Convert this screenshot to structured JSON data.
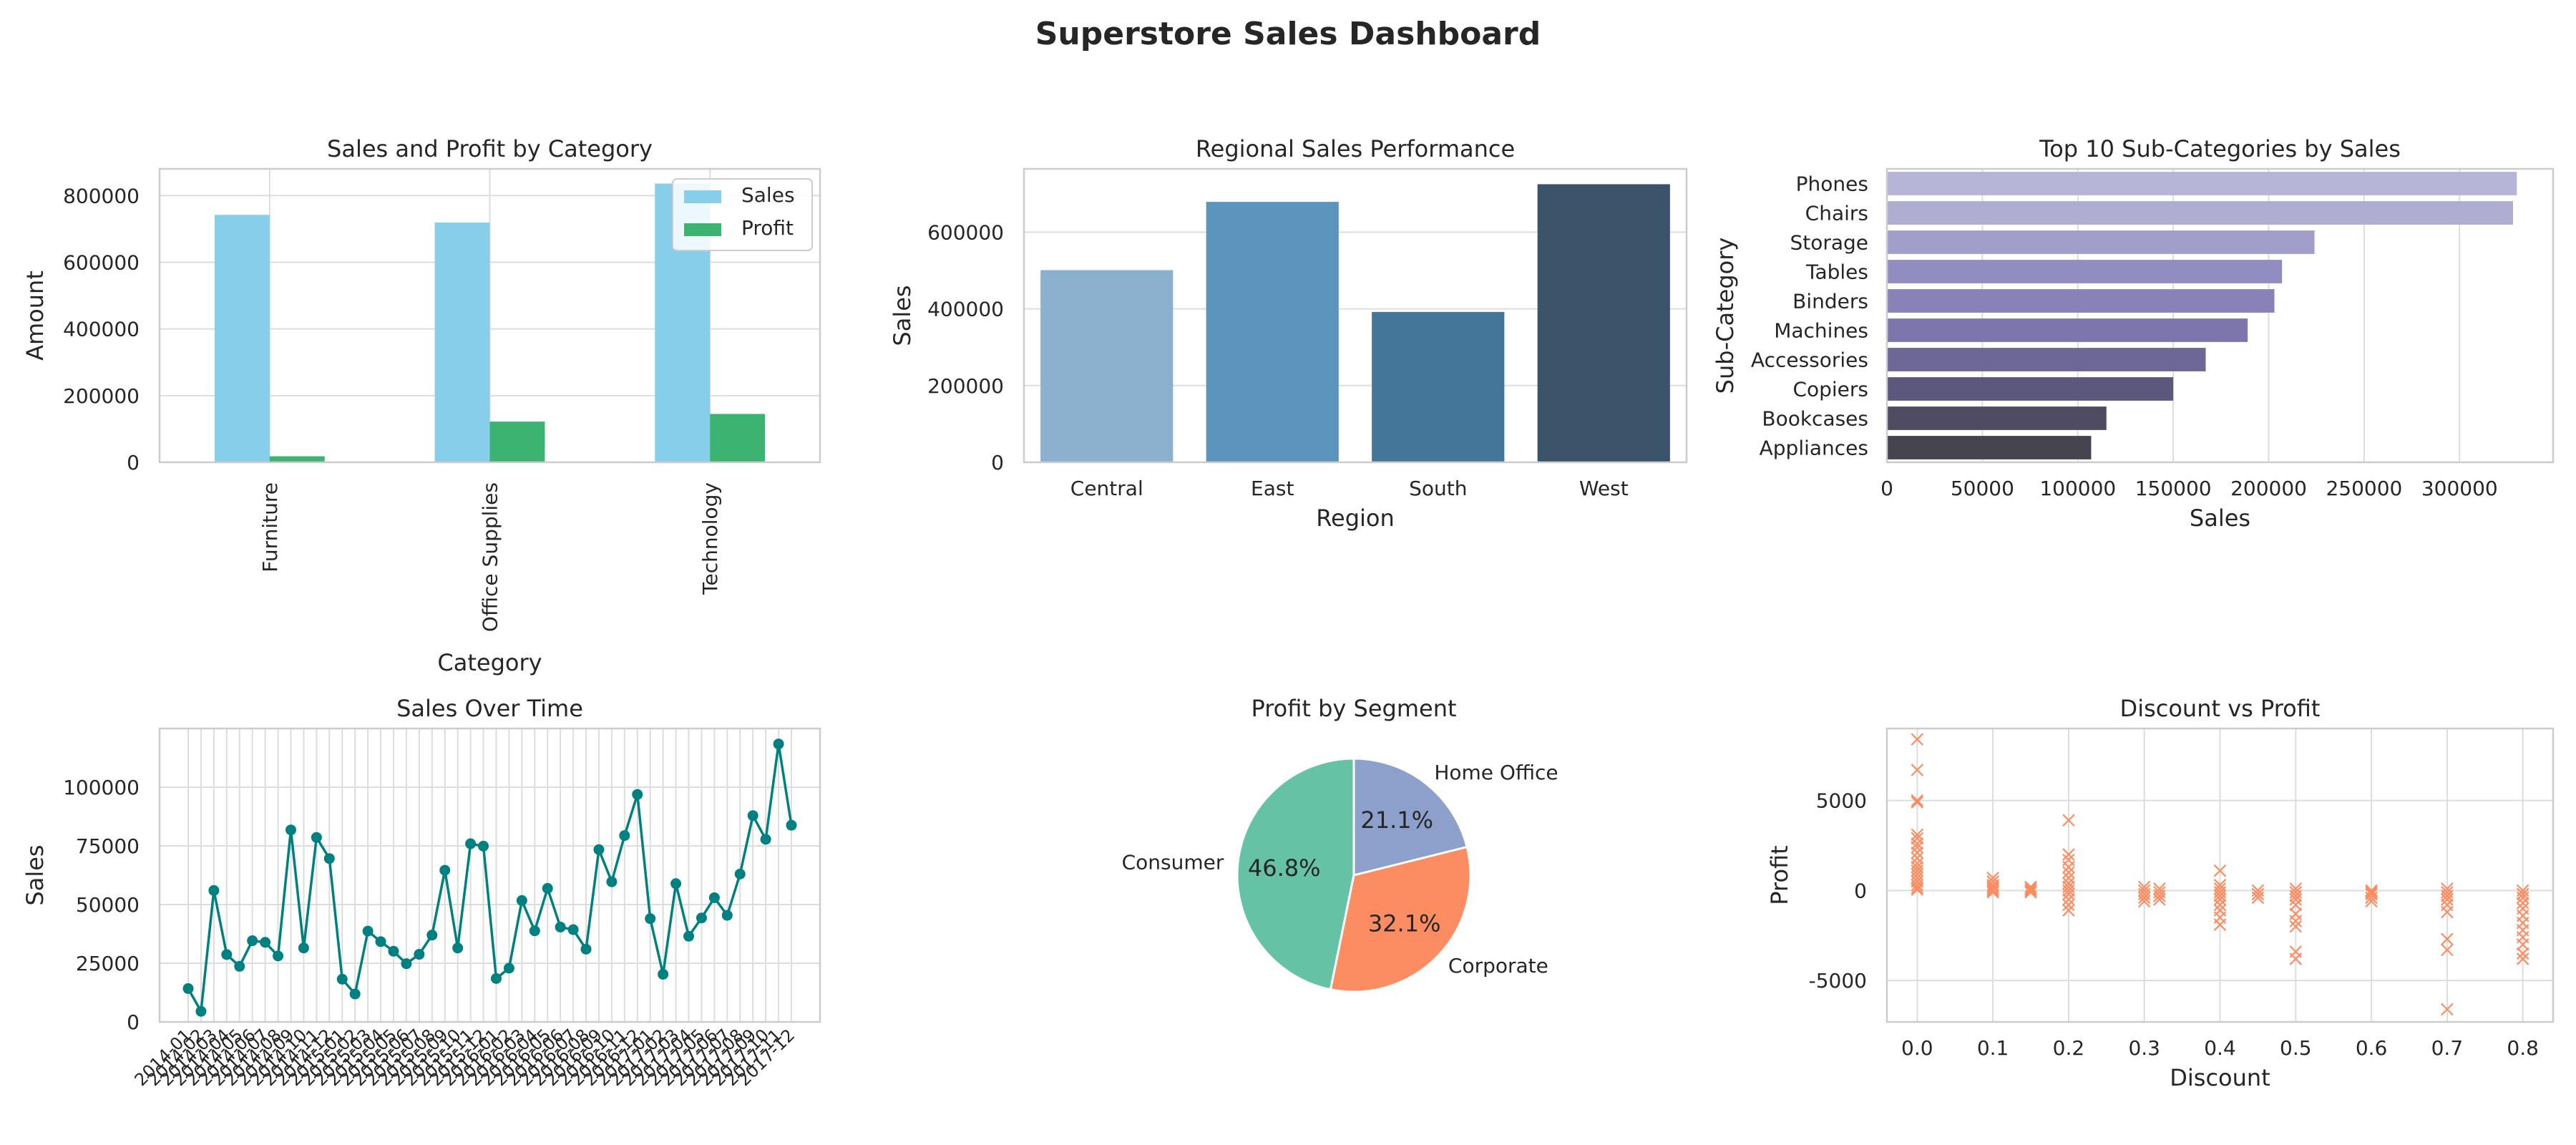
{
  "title": "Superstore Sales Dashboard",
  "colors": {
    "sales": "#87ceeb",
    "profit": "#3cb371",
    "region": [
      "#8ab0cd",
      "#5d94bd",
      "#447699",
      "#3b5369"
    ],
    "subcat": [
      "#b7b5d7",
      "#afacd2",
      "#a19ec9",
      "#928dc0",
      "#8882b8",
      "#7c76ad",
      "#6d6796",
      "#5c587d",
      "#4e4b63",
      "#45434d"
    ],
    "timeline": "#008080",
    "pie": [
      "#66c2a5",
      "#fc8d62",
      "#8da0cb"
    ],
    "scatter": "#fc8d62",
    "grid": "#dddddd",
    "spine": "#cccccc"
  },
  "chart_data": [
    {
      "type": "bar",
      "title": "Sales and Profit by Category",
      "xlabel": "Category",
      "ylabel": "Amount",
      "categories": [
        "Furniture",
        "Office Supplies",
        "Technology"
      ],
      "series": [
        {
          "name": "Sales",
          "values": [
            742000,
            719000,
            836000
          ]
        },
        {
          "name": "Profit",
          "values": [
            18000,
            122000,
            145000
          ]
        }
      ],
      "ylim": [
        0,
        880000
      ],
      "yticks": [
        0,
        200000,
        400000,
        600000,
        800000
      ],
      "legend": "top-right",
      "grid": true
    },
    {
      "type": "bar",
      "title": "Regional Sales Performance",
      "xlabel": "Region",
      "ylabel": "Sales",
      "categories": [
        "Central",
        "East",
        "South",
        "West"
      ],
      "values": [
        501000,
        679000,
        392000,
        725000
      ],
      "ylim": [
        0,
        765000
      ],
      "yticks": [
        0,
        200000,
        400000,
        600000
      ],
      "grid": true
    },
    {
      "type": "bar",
      "orientation": "horizontal",
      "title": "Top 10 Sub-Categories by Sales",
      "xlabel": "Sales",
      "ylabel": "Sub-Category",
      "categories": [
        "Phones",
        "Chairs",
        "Storage",
        "Tables",
        "Binders",
        "Machines",
        "Accessories",
        "Copiers",
        "Bookcases",
        "Appliances"
      ],
      "values": [
        330000,
        328000,
        224000,
        207000,
        203000,
        189000,
        167000,
        150000,
        115000,
        107000
      ],
      "xlim": [
        0,
        349000
      ],
      "xticks": [
        0,
        50000,
        100000,
        150000,
        200000,
        250000,
        300000
      ],
      "grid": true
    },
    {
      "type": "line",
      "title": "Sales Over Time",
      "xlabel": "",
      "ylabel": "Sales",
      "x": [
        "2014-01",
        "2014-02",
        "2014-03",
        "2014-04",
        "2014-05",
        "2014-06",
        "2014-07",
        "2014-08",
        "2014-09",
        "2014-10",
        "2014-11",
        "2014-12",
        "2015-01",
        "2015-02",
        "2015-03",
        "2015-04",
        "2015-05",
        "2015-06",
        "2015-07",
        "2015-08",
        "2015-09",
        "2015-10",
        "2015-11",
        "2015-12",
        "2016-01",
        "2016-02",
        "2016-03",
        "2016-04",
        "2016-05",
        "2016-06",
        "2016-07",
        "2016-08",
        "2016-09",
        "2016-10",
        "2016-11",
        "2016-12",
        "2017-01",
        "2017-02",
        "2017-03",
        "2017-04",
        "2017-05",
        "2017-06",
        "2017-07",
        "2017-08",
        "2017-09",
        "2017-10",
        "2017-11",
        "2017-12"
      ],
      "values": [
        14200,
        4500,
        56000,
        28700,
        23700,
        34600,
        33900,
        28100,
        81800,
        31500,
        78600,
        69600,
        18200,
        11900,
        38700,
        34200,
        30100,
        24800,
        28800,
        37000,
        64600,
        31500,
        75900,
        74900,
        18500,
        22900,
        51700,
        38800,
        56900,
        40400,
        39300,
        31000,
        73400,
        59700,
        79400,
        96900,
        44000,
        20300,
        58900,
        36500,
        44300,
        52900,
        45400,
        63000,
        87900,
        77800,
        118400,
        83800
      ],
      "ylim": [
        0,
        125000
      ],
      "yticks": [
        0,
        25000,
        50000,
        75000,
        100000
      ],
      "grid": true
    },
    {
      "type": "pie",
      "title": "Profit by Segment",
      "labels": [
        "Consumer",
        "Corporate",
        "Home Office"
      ],
      "values": [
        46.8,
        32.1,
        21.1
      ],
      "autopct": [
        "46.8%",
        "32.1%",
        "21.1%"
      ],
      "startangle": 90
    },
    {
      "type": "scatter",
      "title": "Discount vs Profit",
      "xlabel": "Discount",
      "ylabel": "Profit",
      "marker": "x",
      "xlim": [
        -0.04,
        0.84
      ],
      "ylim": [
        -7300,
        9000
      ],
      "xticks": [
        0.0,
        0.1,
        0.2,
        0.3,
        0.4,
        0.5,
        0.6,
        0.7,
        0.8
      ],
      "yticks": [
        -5000,
        0,
        5000
      ],
      "points": [
        [
          0,
          8400
        ],
        [
          0,
          6700
        ],
        [
          0,
          5000
        ],
        [
          0,
          4900
        ],
        [
          0,
          3100
        ],
        [
          0,
          2900
        ],
        [
          0,
          2600
        ],
        [
          0,
          2400
        ],
        [
          0,
          2100
        ],
        [
          0,
          1800
        ],
        [
          0,
          1500
        ],
        [
          0,
          1300
        ],
        [
          0,
          1100
        ],
        [
          0,
          900
        ],
        [
          0,
          700
        ],
        [
          0,
          500
        ],
        [
          0,
          300
        ],
        [
          0,
          150
        ],
        [
          0,
          50
        ],
        [
          0.1,
          700
        ],
        [
          0.1,
          500
        ],
        [
          0.1,
          300
        ],
        [
          0.1,
          200
        ],
        [
          0.1,
          100
        ],
        [
          0.1,
          0
        ],
        [
          0.1,
          -100
        ],
        [
          0.15,
          200
        ],
        [
          0.15,
          100
        ],
        [
          0.15,
          0
        ],
        [
          0.15,
          -100
        ],
        [
          0.2,
          3900
        ],
        [
          0.2,
          2000
        ],
        [
          0.2,
          1700
        ],
        [
          0.2,
          1300
        ],
        [
          0.2,
          1000
        ],
        [
          0.2,
          700
        ],
        [
          0.2,
          400
        ],
        [
          0.2,
          200
        ],
        [
          0.2,
          0
        ],
        [
          0.2,
          -200
        ],
        [
          0.2,
          -500
        ],
        [
          0.2,
          -800
        ],
        [
          0.2,
          -1100
        ],
        [
          0.3,
          200
        ],
        [
          0.3,
          0
        ],
        [
          0.3,
          -200
        ],
        [
          0.3,
          -400
        ],
        [
          0.3,
          -600
        ],
        [
          0.32,
          100
        ],
        [
          0.32,
          -100
        ],
        [
          0.32,
          -300
        ],
        [
          0.32,
          -500
        ],
        [
          0.4,
          1100
        ],
        [
          0.4,
          300
        ],
        [
          0.4,
          100
        ],
        [
          0.4,
          -100
        ],
        [
          0.4,
          -300
        ],
        [
          0.4,
          -500
        ],
        [
          0.4,
          -800
        ],
        [
          0.4,
          -1100
        ],
        [
          0.4,
          -1500
        ],
        [
          0.4,
          -1900
        ],
        [
          0.45,
          0
        ],
        [
          0.45,
          -200
        ],
        [
          0.45,
          -400
        ],
        [
          0.5,
          100
        ],
        [
          0.5,
          -100
        ],
        [
          0.5,
          -300
        ],
        [
          0.5,
          -500
        ],
        [
          0.5,
          -800
        ],
        [
          0.5,
          -1300
        ],
        [
          0.5,
          -1700
        ],
        [
          0.5,
          -2000
        ],
        [
          0.5,
          -3400
        ],
        [
          0.5,
          -3800
        ],
        [
          0.6,
          0
        ],
        [
          0.6,
          -100
        ],
        [
          0.6,
          -200
        ],
        [
          0.6,
          -400
        ],
        [
          0.6,
          -600
        ],
        [
          0.7,
          100
        ],
        [
          0.7,
          -100
        ],
        [
          0.7,
          -300
        ],
        [
          0.7,
          -500
        ],
        [
          0.7,
          -800
        ],
        [
          0.7,
          -1200
        ],
        [
          0.7,
          -2700
        ],
        [
          0.7,
          -3300
        ],
        [
          0.7,
          -6600
        ],
        [
          0.8,
          0
        ],
        [
          0.8,
          -200
        ],
        [
          0.8,
          -400
        ],
        [
          0.8,
          -700
        ],
        [
          0.8,
          -1000
        ],
        [
          0.8,
          -1400
        ],
        [
          0.8,
          -1800
        ],
        [
          0.8,
          -2200
        ],
        [
          0.8,
          -2600
        ],
        [
          0.8,
          -3000
        ],
        [
          0.8,
          -3500
        ],
        [
          0.8,
          -3800
        ]
      ],
      "grid": true
    }
  ]
}
